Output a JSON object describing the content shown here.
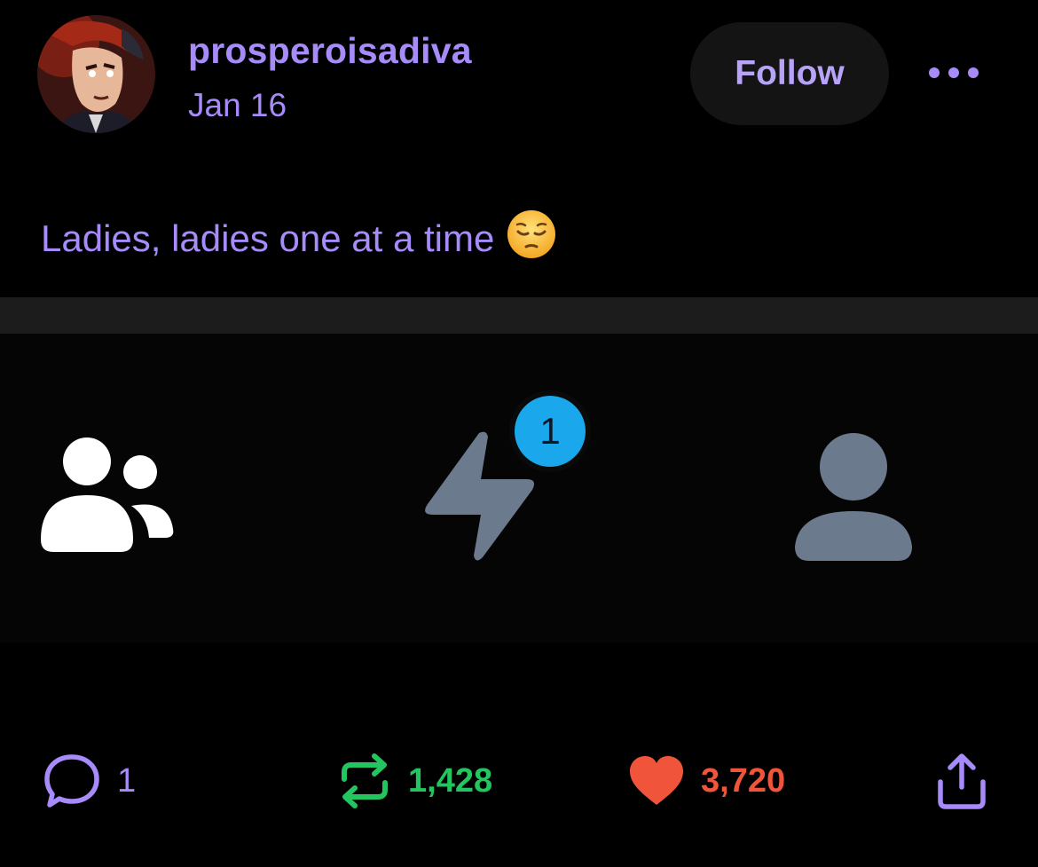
{
  "post": {
    "username": "prosperoisadiva",
    "date": "Jan 16",
    "text": "Ladies, ladies one at a time",
    "emoji": "😔",
    "follow_label": "Follow"
  },
  "embed": {
    "tabs": [
      {
        "icon": "people-icon",
        "active": true
      },
      {
        "icon": "lightning-icon",
        "active": false
      },
      {
        "icon": "person-icon",
        "active": false
      }
    ],
    "badge_count": "1"
  },
  "actions": {
    "replies": "1",
    "reposts": "1,428",
    "likes": "3,720"
  },
  "colors": {
    "accent": "#a78bfa",
    "repost": "#22c55e",
    "like": "#f0553b",
    "badge": "#1aa7ec",
    "icon_inactive": "#6b7a8c"
  }
}
